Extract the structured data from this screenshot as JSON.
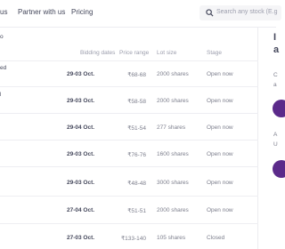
{
  "nav": {
    "links": [
      "us",
      "Partner with us",
      "Pricing"
    ],
    "search_placeholder": "Search any stock (E.g"
  },
  "table": {
    "header_fragment": "o",
    "columns": [
      "Bidding dates",
      "Price range",
      "Lot size",
      "Stage"
    ],
    "rows": [
      {
        "name_fragment": "ed",
        "bidding_dates": "29-03 Oct.",
        "price_range": "₹68-68",
        "lot_size": "2000 shares",
        "stage": "Open now"
      },
      {
        "name_fragment": "l",
        "bidding_dates": "29-03 Oct.",
        "price_range": "₹58-58",
        "lot_size": "2000 shares",
        "stage": "Open now"
      },
      {
        "name_fragment": "",
        "bidding_dates": "29-04 Oct.",
        "price_range": "₹51-54",
        "lot_size": "277 shares",
        "stage": "Open now"
      },
      {
        "name_fragment": "",
        "bidding_dates": "29-03 Oct.",
        "price_range": "₹76-76",
        "lot_size": "1600 shares",
        "stage": "Open now"
      },
      {
        "name_fragment": "",
        "bidding_dates": "29-03 Oct.",
        "price_range": "₹48-48",
        "lot_size": "3000 shares",
        "stage": "Open now"
      },
      {
        "name_fragment": "",
        "bidding_dates": "27-04 Oct.",
        "price_range": "₹51-51",
        "lot_size": "2000 shares",
        "stage": "Open now"
      },
      {
        "name_fragment": "",
        "bidding_dates": "27-03 Oct.",
        "price_range": "₹133-140",
        "lot_size": "105 shares",
        "stage": "Closed"
      }
    ]
  },
  "aside": {
    "heading_line1": "I",
    "heading_line2": "a",
    "text1": "C",
    "text2": "a",
    "text3": "A",
    "text4": "U"
  },
  "colors": {
    "accent": "#5b2a8a",
    "text": "#44475b",
    "muted": "#9b9dac"
  }
}
